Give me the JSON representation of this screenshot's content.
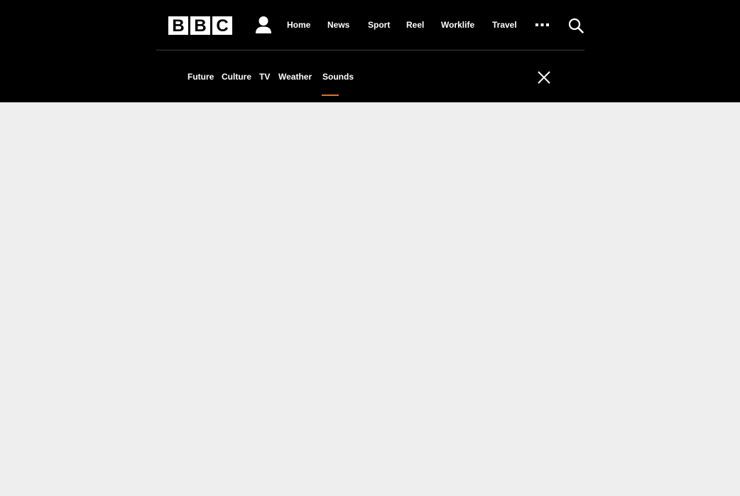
{
  "brand": {
    "logo_letters": [
      "B",
      "B",
      "C"
    ]
  },
  "header": {
    "nav": [
      {
        "label": "Home"
      },
      {
        "label": "News"
      },
      {
        "label": "Sport"
      },
      {
        "label": "Reel"
      },
      {
        "label": "Worklife"
      },
      {
        "label": "Travel"
      }
    ],
    "icons": {
      "account": "account-icon",
      "more": "more-icon",
      "search": "search-icon"
    }
  },
  "subnav": {
    "items": [
      {
        "label": "Future"
      },
      {
        "label": "Culture"
      },
      {
        "label": "TV"
      },
      {
        "label": "Weather"
      },
      {
        "label": "Sounds"
      }
    ],
    "active_label": "Sounds",
    "close_icon": "close-icon"
  },
  "colors": {
    "header_bg": "#000000",
    "page_bg": "#eeeeee",
    "accent": "#ff6b00",
    "text": "#ffffff"
  }
}
